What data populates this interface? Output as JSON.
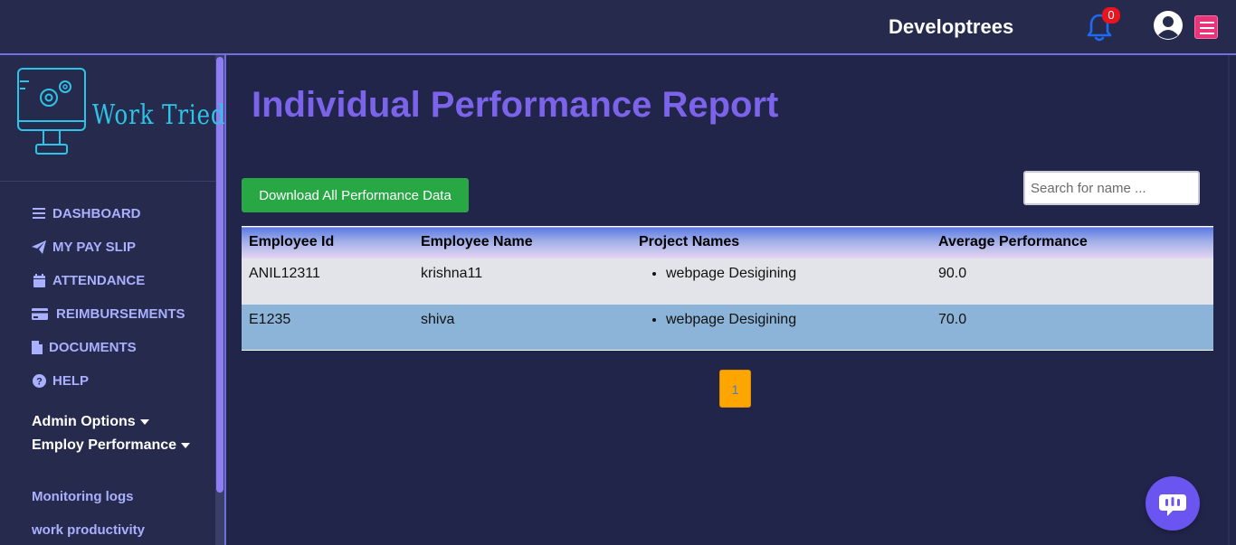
{
  "header": {
    "brand": "Developtrees",
    "notification_count": "0",
    "accent_color": "#6f6fe0",
    "icons": [
      "bell-icon",
      "user-circle-icon",
      "hamburger-menu-icon"
    ]
  },
  "sidebar": {
    "logo_text": "Work Tried",
    "nav_items": [
      {
        "label": "DASHBOARD",
        "icon": "list-icon"
      },
      {
        "label": "MY PAY SLIP",
        "icon": "paper-plane-icon"
      },
      {
        "label": "ATTENDANCE",
        "icon": "calendar-icon"
      },
      {
        "label": "REIMBURSEMENTS",
        "icon": "credit-card-icon"
      },
      {
        "label": "DOCUMENTS",
        "icon": "file-icon"
      },
      {
        "label": "HELP",
        "icon": "question-circle-icon"
      }
    ],
    "admin_options": "Admin Options",
    "employ_performance": "Employ Performance",
    "sub_links": [
      "Monitoring logs",
      "work productivity"
    ]
  },
  "main": {
    "title": "Individual Performance Report",
    "download_label": "Download All Performance Data",
    "search_placeholder": "Search for name ...",
    "table": {
      "headers": [
        "Employee Id",
        "Employee Name",
        "Project Names",
        "Average Performance"
      ],
      "rows": [
        {
          "id": "ANIL12311",
          "name": "krishna11",
          "project": "webpage Desigining",
          "avg": "90.0"
        },
        {
          "id": "E1235",
          "name": "shiva",
          "project": "webpage Desigining",
          "avg": "70.0"
        }
      ]
    },
    "pagination": {
      "current": "1"
    }
  },
  "colors": {
    "title": "#7b63ea",
    "download_button": "#28a745",
    "page_button": "#ffa500",
    "chat_button": "#6a55f0"
  }
}
